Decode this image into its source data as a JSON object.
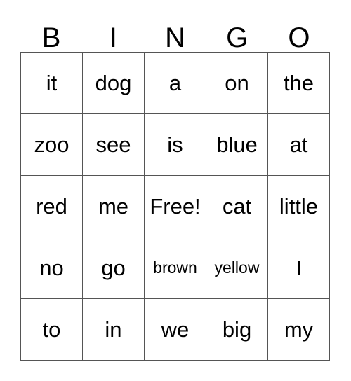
{
  "card": {
    "title_letters": [
      "B",
      "I",
      "N",
      "G",
      "O"
    ],
    "colors": {
      "background": "#ffffff",
      "text": "#000000",
      "grid_line": "#555555"
    },
    "grid": {
      "columns": 5,
      "rows": 5,
      "free_space": {
        "row": 2,
        "col": 2,
        "label": "Free!"
      },
      "cells": [
        [
          {
            "text": "it",
            "small": false
          },
          {
            "text": "dog",
            "small": false
          },
          {
            "text": "a",
            "small": false
          },
          {
            "text": "on",
            "small": false
          },
          {
            "text": "the",
            "small": false
          }
        ],
        [
          {
            "text": "zoo",
            "small": false
          },
          {
            "text": "see",
            "small": false
          },
          {
            "text": "is",
            "small": false
          },
          {
            "text": "blue",
            "small": false
          },
          {
            "text": "at",
            "small": false
          }
        ],
        [
          {
            "text": "red",
            "small": false
          },
          {
            "text": "me",
            "small": false
          },
          {
            "text": "Free!",
            "small": false
          },
          {
            "text": "cat",
            "small": false
          },
          {
            "text": "little",
            "small": false
          }
        ],
        [
          {
            "text": "no",
            "small": false
          },
          {
            "text": "go",
            "small": false
          },
          {
            "text": "brown",
            "small": true
          },
          {
            "text": "yellow",
            "small": true
          },
          {
            "text": "I",
            "small": false
          }
        ],
        [
          {
            "text": "to",
            "small": false
          },
          {
            "text": "in",
            "small": false
          },
          {
            "text": "we",
            "small": false
          },
          {
            "text": "big",
            "small": false
          },
          {
            "text": "my",
            "small": false
          }
        ]
      ]
    }
  }
}
